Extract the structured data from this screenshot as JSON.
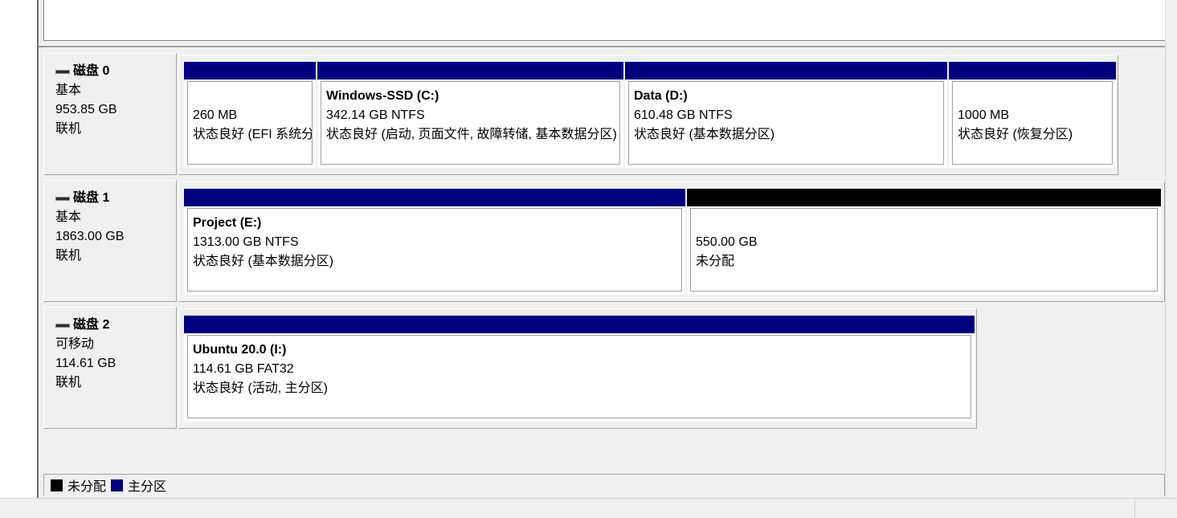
{
  "disks": [
    {
      "name": "磁盘 0",
      "type": "基本",
      "size": "953.85 GB",
      "status": "联机",
      "partitions": [
        {
          "title": "",
          "size_fs": "260 MB",
          "status": "状态良好 (EFI 系统分区)",
          "kind": "primary"
        },
        {
          "title": "Windows-SSD  (C:)",
          "size_fs": "342.14 GB NTFS",
          "status": "状态良好 (启动, 页面文件, 故障转储, 基本数据分区)",
          "kind": "primary"
        },
        {
          "title": "Data  (D:)",
          "size_fs": "610.48 GB NTFS",
          "status": "状态良好 (基本数据分区)",
          "kind": "primary"
        },
        {
          "title": "",
          "size_fs": "1000 MB",
          "status": "状态良好 (恢复分区)",
          "kind": "primary"
        }
      ]
    },
    {
      "name": "磁盘 1",
      "type": "基本",
      "size": "1863.00 GB",
      "status": "联机",
      "partitions": [
        {
          "title": "Project  (E:)",
          "size_fs": "1313.00 GB NTFS",
          "status": "状态良好 (基本数据分区)",
          "kind": "primary"
        },
        {
          "title": "",
          "size_fs": "550.00 GB",
          "status": "未分配",
          "kind": "unallocated"
        }
      ]
    },
    {
      "name": "磁盘 2",
      "type": "可移动",
      "size": "114.61 GB",
      "status": "联机",
      "partitions": [
        {
          "title": "Ubuntu 20.0  (I:)",
          "size_fs": "114.61 GB FAT32",
          "status": "状态良好 (活动, 主分区)",
          "kind": "primary"
        }
      ]
    }
  ],
  "legend": [
    {
      "label": "未分配",
      "color": "#000000"
    },
    {
      "label": "主分区",
      "color": "#00007f"
    }
  ]
}
